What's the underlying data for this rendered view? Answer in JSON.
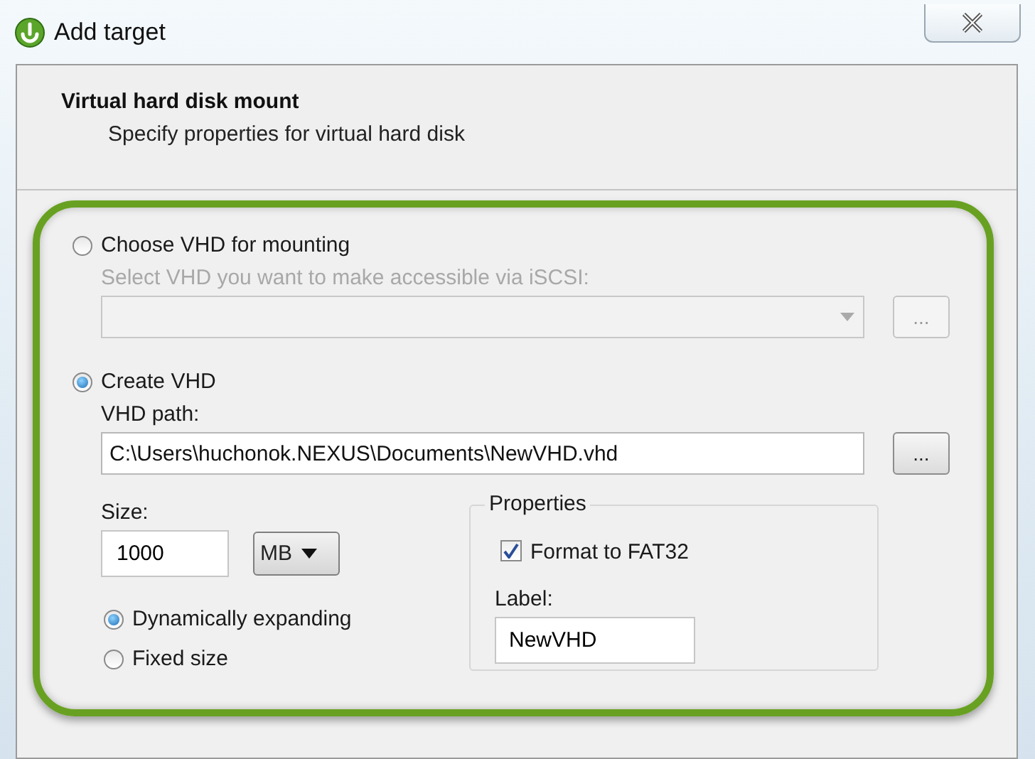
{
  "window": {
    "title": "Add target"
  },
  "header": {
    "title": "Virtual hard disk mount",
    "subtitle": "Specify properties for virtual hard disk"
  },
  "sources": [
    {
      "kind": "dropdown",
      "label": "Choose VHD for mounting",
      "selected": false,
      "field_label": "Select VHD you want to make accessible via iSCSI:",
      "browse_button": "..."
    },
    {
      "kind": "path",
      "label": "Create VHD",
      "selected": true,
      "field_label": "VHD path:",
      "value": "C:\\Users\\huchonok.NEXUS\\Documents\\NewVHD.vhd",
      "browse_button": "..."
    }
  ],
  "size": {
    "label": "Size:",
    "value": "1000",
    "unit": "MB"
  },
  "size_types": [
    {
      "label": "Dynamically expanding",
      "selected": true
    },
    {
      "label": "Fixed size",
      "selected": false
    }
  ],
  "properties": {
    "title": "Properties",
    "format": {
      "label": "Format to FAT32",
      "checked": true
    },
    "label_label": "Label:",
    "label_value": "NewVHD"
  }
}
